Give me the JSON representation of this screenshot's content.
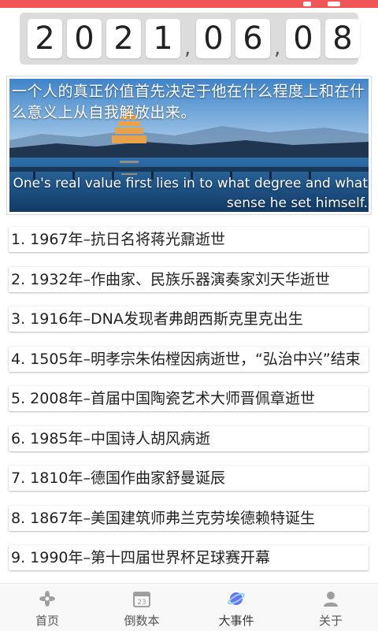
{
  "date_digits": [
    {
      "char": "2",
      "kind": "digit"
    },
    {
      "char": "0",
      "kind": "digit"
    },
    {
      "char": "2",
      "kind": "digit"
    },
    {
      "char": "1",
      "kind": "digit"
    },
    {
      "char": ",",
      "kind": "sep"
    },
    {
      "char": "0",
      "kind": "digit"
    },
    {
      "char": "6",
      "kind": "digit"
    },
    {
      "char": ",",
      "kind": "sep"
    },
    {
      "char": "0",
      "kind": "digit"
    },
    {
      "char": "8",
      "kind": "digit"
    }
  ],
  "banner": {
    "quote_cn": "一个人的真正价值首先决定于他在什么程度上和在什么意义上从自我解放出来。",
    "quote_en": "One's real value first lies in to what degree and what sense he set himself."
  },
  "events": [
    "1. 1967年–抗日名将蒋光鼐逝世",
    "2. 1932年–作曲家、民族乐器演奏家刘天华逝世",
    "3. 1916年–DNA发现者弗朗西斯克里克出生",
    "4. 1505年–明孝宗朱佑樘因病逝世，“弘治中兴”结束",
    "5. 2008年–首届中国陶瓷艺术大师晋佩章逝世",
    "6. 1985年–中国诗人胡风病逝",
    "7. 1810年–德国作曲家舒曼诞辰",
    "8. 1867年–美国建筑师弗兰克劳埃德赖特诞生",
    "9. 1990年–第十四届世界杯足球赛开幕"
  ],
  "tabs": [
    {
      "label": "首页",
      "icon": "flower-icon",
      "color": "#9e9e9e"
    },
    {
      "label": "倒数本",
      "icon": "calendar-23-icon",
      "color": "#9e9e9e"
    },
    {
      "label": "大事件",
      "icon": "planet-icon",
      "color": "#6b6ff0",
      "active": true
    },
    {
      "label": "关于",
      "icon": "person-icon",
      "color": "#9e9e9e"
    }
  ],
  "calendar_icon_text": "23",
  "colors": {
    "status_bar": "#f25556",
    "accent": "#6b6ff0"
  }
}
